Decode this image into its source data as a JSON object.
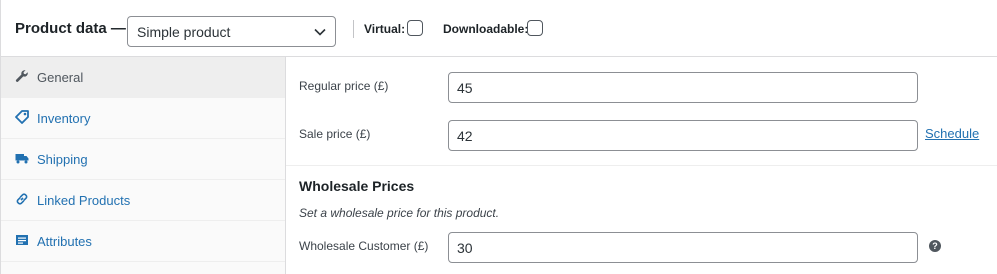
{
  "header": {
    "title": "Product data —",
    "product_type": "Simple product",
    "virtual_label": "Virtual:",
    "virtual_checked": false,
    "downloadable_label": "Downloadable:",
    "downloadable_checked": false
  },
  "tabs": [
    {
      "label": "General",
      "icon": "wrench-icon",
      "active": true
    },
    {
      "label": "Inventory",
      "icon": "tag-icon",
      "active": false
    },
    {
      "label": "Shipping",
      "icon": "truck-icon",
      "active": false
    },
    {
      "label": "Linked Products",
      "icon": "link-icon",
      "active": false
    },
    {
      "label": "Attributes",
      "icon": "list-icon",
      "active": false
    }
  ],
  "general": {
    "regular_price_label": "Regular price (£)",
    "regular_price": "45",
    "sale_price_label": "Sale price (£)",
    "sale_price": "42",
    "schedule_link": "Schedule"
  },
  "wholesale": {
    "title": "Wholesale Prices",
    "description": "Set a wholesale price for this product.",
    "customer_label": "Wholesale Customer (£)",
    "customer_price": "30",
    "help_icon": "?"
  },
  "colors": {
    "link": "#2271b1",
    "border": "#dcdcde",
    "tab_bg": "#fafafa",
    "active_tab_bg": "#eeeeee"
  }
}
